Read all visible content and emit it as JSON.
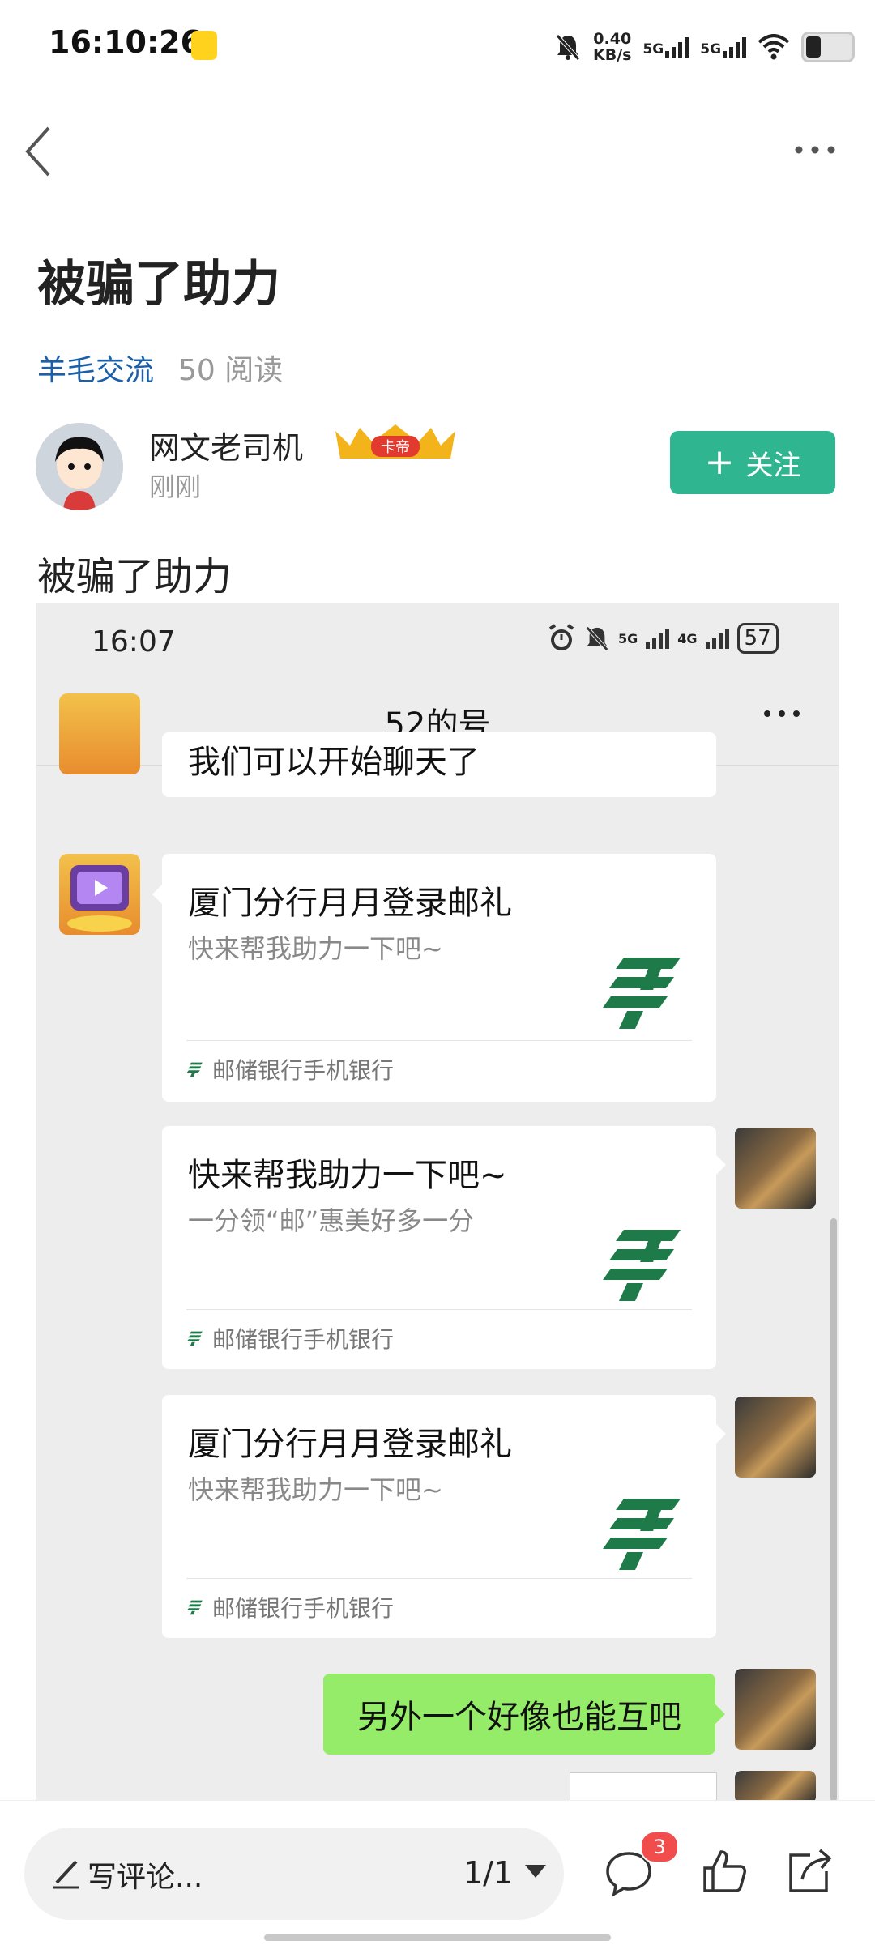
{
  "status_bar": {
    "time": "16:10:26",
    "speed_value": "0.40",
    "speed_unit": "KB/s",
    "net1": "5G",
    "net2": "5G"
  },
  "post": {
    "title": "被骗了助力",
    "circle": "羊毛交流",
    "reads": "50 阅读",
    "author": {
      "name": "网文老司机",
      "badge": "卡帝",
      "time": "刚刚"
    },
    "follow_label": "关注",
    "follow_plus": "+",
    "body": "被骗了助力"
  },
  "embedded": {
    "status_time": "16:07",
    "net_5g": "5G",
    "net_4g": "4G",
    "battery": "57",
    "chat_title": "52的号",
    "partial_message": "我们可以开始聊天了",
    "cards": [
      {
        "title": "厦门分行月月登录邮礼",
        "desc": "快来帮我助力一下吧~",
        "source": "邮储银行手机银行",
        "side": "left"
      },
      {
        "title": "快来帮我助力一下吧~",
        "desc": "一分领“邮”惠美好多一分",
        "source": "邮储银行手机银行",
        "side": "right"
      },
      {
        "title": "厦门分行月月登录邮礼",
        "desc": "快来帮我助力一下吧~",
        "source": "邮储银行手机银行",
        "side": "right"
      }
    ],
    "green_message": "另外一个好像也能互吧",
    "brand_color": "#1f7a4a"
  },
  "bottom_bar": {
    "comment_placeholder": "写评论...",
    "page_indicator": "1/1",
    "comment_count": "3"
  },
  "colors": {
    "accent_green": "#2fb58f",
    "link_blue": "#1a5fa8",
    "chat_green": "#95ec69",
    "badge_red": "#f24d4d"
  }
}
